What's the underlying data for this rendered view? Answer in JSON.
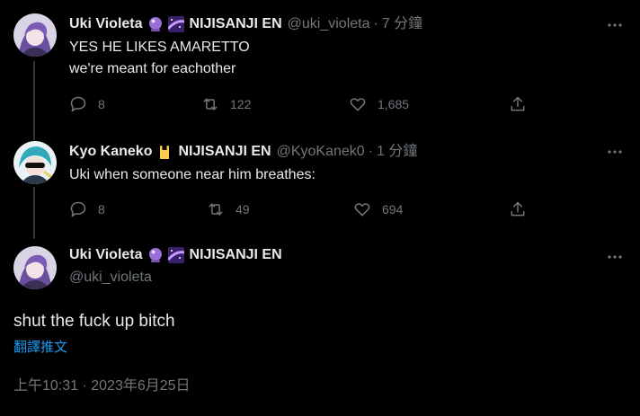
{
  "tweets": [
    {
      "display_name": "Uki Violeta",
      "affiliation": "NIJISANJI EN",
      "handle": "@uki_violeta",
      "separator": "·",
      "time": "7 分鐘",
      "lines": [
        "YES HE LIKES AMARETTO",
        "we're meant for eachother"
      ],
      "replies": "8",
      "retweets": "122",
      "likes": "1,685"
    },
    {
      "display_name": "Kyo Kaneko",
      "affiliation": "NIJISANJI EN",
      "handle": "@KyoKanek0",
      "separator": "·",
      "time": "1 分鐘",
      "lines": [
        "Uki when someone near him breathes:"
      ],
      "replies": "8",
      "retweets": "49",
      "likes": "694"
    }
  ],
  "main_tweet": {
    "display_name": "Uki Violeta",
    "affiliation": "NIJISANJI EN",
    "handle": "@uki_violeta",
    "text": "shut the fuck up bitch",
    "translate_label": "翻譯推文",
    "timestamp": "上午10:31 · 2023年6月25日"
  },
  "icons": {
    "reply": "reply-icon",
    "retweet": "retweet-icon",
    "like": "like-icon",
    "share": "share-icon",
    "more": "more-icon"
  },
  "colors": {
    "background": "#000000",
    "text": "#e7e9ea",
    "muted": "#71767b",
    "link": "#1d9bf0",
    "thread_line": "#333639"
  }
}
